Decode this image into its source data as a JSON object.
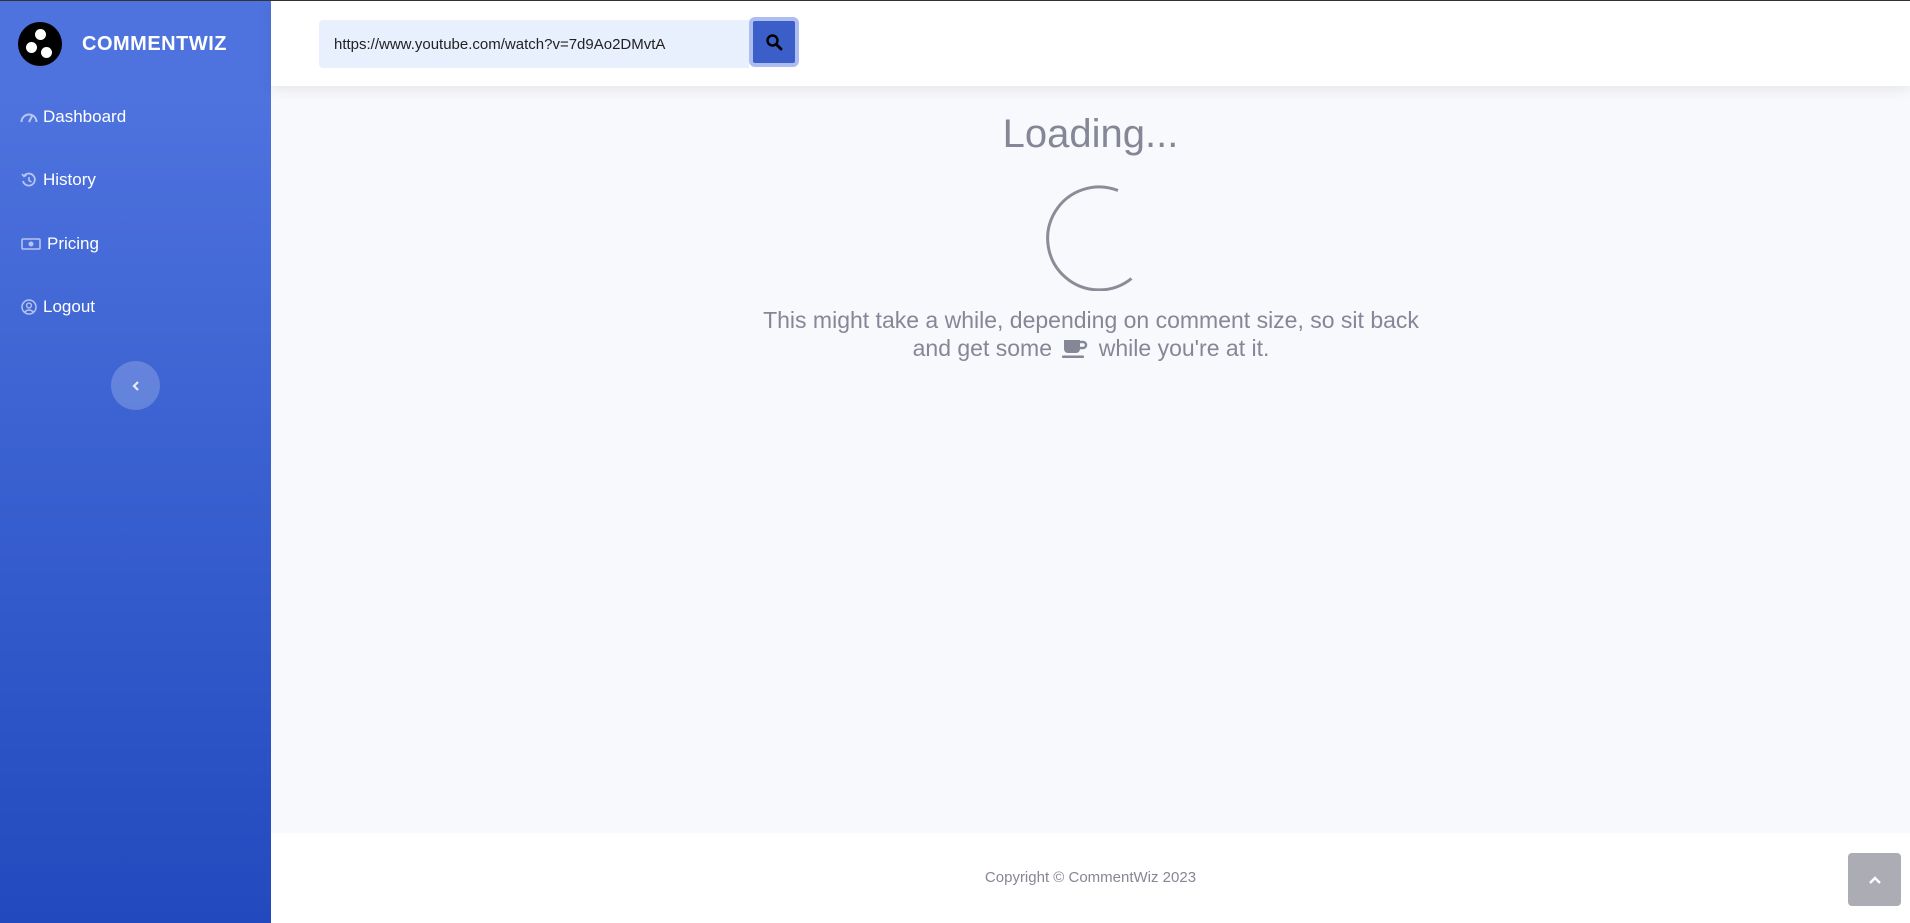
{
  "brand": {
    "name": "COMMENTWIZ",
    "logo_icon": "logo-dots-icon"
  },
  "sidebar": {
    "items": [
      {
        "label": "Dashboard",
        "icon": "speedometer-icon"
      },
      {
        "label": "History",
        "icon": "history-icon"
      },
      {
        "label": "Pricing",
        "icon": "money-bill-icon"
      },
      {
        "label": "Logout",
        "icon": "user-circle-icon"
      }
    ],
    "collapse_icon": "chevron-left-icon"
  },
  "search": {
    "value": "https://www.youtube.com/watch?v=7d9Ao2DMvtA",
    "button_icon": "search-icon"
  },
  "main": {
    "loading_title": "Loading...",
    "message_line1": "This might take a while, depending on comment size, so sit back",
    "message_line2_before": "and get some",
    "message_line2_icon": "coffee-cup-icon",
    "message_line2_after": "while you're at it."
  },
  "footer": {
    "copyright": "Copyright © CommentWiz 2023"
  },
  "scroll_top_icon": "chevron-up-icon",
  "colors": {
    "sidebar_top": "#4e73df",
    "sidebar_bottom": "#224abe",
    "accent": "#3b5ec9",
    "muted_text": "#858796"
  }
}
